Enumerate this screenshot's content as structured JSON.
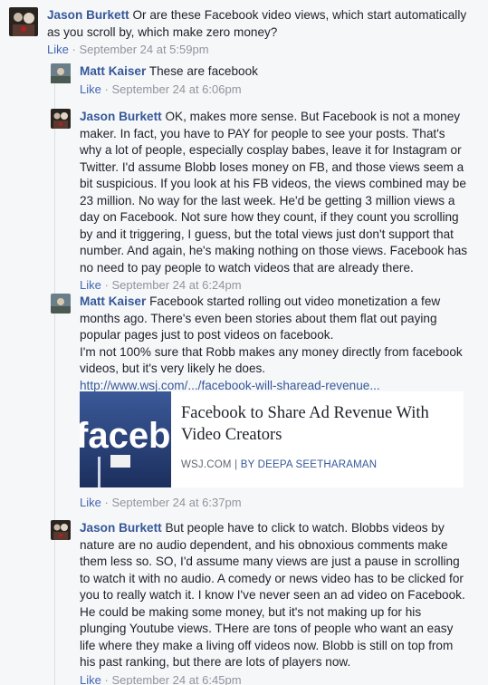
{
  "meta": {
    "like_label": "Like",
    "separator": "·"
  },
  "comments": [
    {
      "author": "Jason Burkett",
      "lines": [
        "Or are these Facebook video views, which start automatically",
        "as you scroll by, which make zero money?"
      ],
      "date": "September 24 at 5:59pm"
    },
    {
      "author": "Matt Kaiser",
      "lines": [
        "These are facebook"
      ],
      "date": "September 24 at 6:06pm"
    },
    {
      "author": "Jason Burkett",
      "lines": [
        "OK, makes more sense. But Facebook is not a money",
        "maker. In fact, you have to PAY for people to see your posts. That's",
        "why a lot of people, especially cosplay babes, leave it for Instagram or",
        "Twitter. I'd assume Blobb loses money on FB, and those views seem a",
        "bit suspicious. If you look at his FB videos, the views combined may be",
        "23 million. No way for the last week. He'd be getting 3 million views a",
        "day on Facebook. Not sure how they count, if they count you scrolling",
        "by and it triggering, I guess, but the total views just don't support that",
        "number. And again, he's making nothing on those views. Facebook has",
        "no need to pay people to watch videos that are already there."
      ],
      "date": "September 24 at 6:24pm"
    },
    {
      "author": "Matt Kaiser",
      "lines": [
        "Facebook started rolling out video monetization a few",
        "months ago. There's even been stories about them flat out paying",
        "popular pages just to post videos on facebook.",
        "I'm not 100% sure that Robb makes any money directly from facebook",
        "videos, but it's very likely he does."
      ],
      "link": "http://www.wsj.com/.../facebook-will-sharead-revenue...",
      "preview": {
        "title_line1": "Facebook to Share Ad Revenue With",
        "title_line2": "Video Creators",
        "source": "WSJ.COM",
        "divider": "|",
        "byline": "BY DEEPA SEETHARAMAN",
        "image_text": "faceb"
      },
      "date": "September 24 at 6:37pm"
    },
    {
      "author": "Jason Burkett",
      "lines": [
        "But people have to click to watch. Blobbs videos by",
        "nature are no audio dependent, and his obnoxious comments make",
        "them less so. SO, I'd assume many views are just a pause in scrolling",
        "to watch it with no audio. A comedy or news video has to be clicked for",
        "you to really watch it. I know I've never seen an ad video on Facebook.",
        "He could be making some money, but it's not making up for his",
        "plunging Youtube views. THere are tons of people who want an easy",
        "life where they make a living off videos now. Blobb is still on top from",
        "his past ranking, but there are lots of players now."
      ],
      "date": "September 24 at 6:45pm"
    }
  ]
}
